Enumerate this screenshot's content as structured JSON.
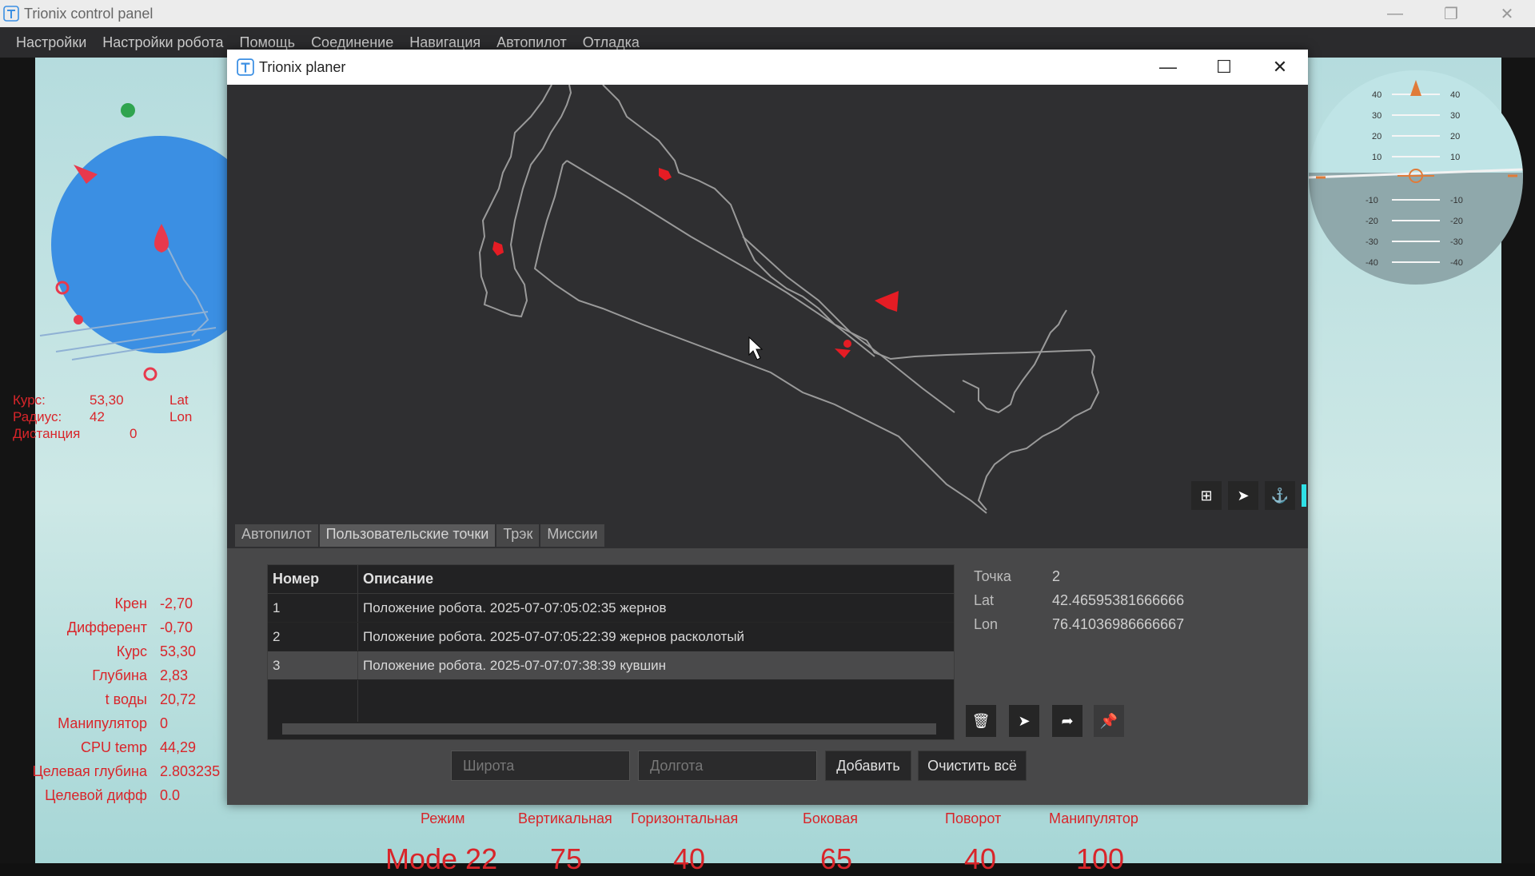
{
  "app": {
    "title": "Trionix control panel"
  },
  "menu": [
    "Настройки",
    "Настройки робота",
    "Помощь",
    "Соединение",
    "Навигация",
    "Автопилот",
    "Отладка"
  ],
  "course_info": [
    {
      "label": "Курс:",
      "value": "53,30",
      "extra": "Lat"
    },
    {
      "label": "Радиус:",
      "value": "42",
      "extra": "Lon"
    },
    {
      "label": "Дистанция",
      "value": "0",
      "extra": ""
    }
  ],
  "telemetry": [
    {
      "label": "Крен",
      "value": "-2,70"
    },
    {
      "label": "Дифферент",
      "value": "-0,70"
    },
    {
      "label": "Курс",
      "value": "53,30"
    },
    {
      "label": "Глубина",
      "value": "2,83"
    },
    {
      "label": "t воды",
      "value": "20,72"
    },
    {
      "label": "Манипулятор",
      "value": "0"
    },
    {
      "label": "CPU temp",
      "value": "44,29"
    },
    {
      "label": "Целевая глубина",
      "value": "2.803235"
    },
    {
      "label": "Целевой дифф",
      "value": "0.0"
    }
  ],
  "bottom_labels": [
    "Режим",
    "Вертикальная",
    "Горизонтальная",
    "Боковая",
    "Поворот",
    "Манипулятор"
  ],
  "bottom_values": [
    "Mode 22",
    "75",
    "40",
    "65",
    "40",
    "100"
  ],
  "horizon_scale": [
    "40",
    "30",
    "20",
    "10",
    "-10",
    "-20",
    "-30",
    "-40"
  ],
  "planer": {
    "title": "Trionix planer",
    "tabs": [
      "Автопилот",
      "Пользовательские точки",
      "Трэк",
      "Миссии"
    ],
    "active_tab": 1,
    "table": {
      "headers": [
        "Номер",
        "Описание"
      ],
      "rows": [
        {
          "num": "1",
          "desc": "Положение робота. 2025-07-07:05:02:35 жернов"
        },
        {
          "num": "2",
          "desc": "Положение робота. 2025-07-07:05:22:39 жернов расколотый"
        },
        {
          "num": "3",
          "desc": "Положение робота. 2025-07-07:07:38:39 кувшин"
        }
      ],
      "selected_row": 2
    },
    "details": [
      {
        "label": "Точка",
        "value": "2"
      },
      {
        "label": "Lat",
        "value": "42.46595381666666"
      },
      {
        "label": "Lon",
        "value": "76.41036986666667"
      }
    ],
    "inputs": {
      "lat_placeholder": "Широта",
      "lon_placeholder": "Долгота"
    },
    "buttons": {
      "add": "Добавить",
      "clear": "Очистить всё"
    },
    "map_icons": [
      "add-point-icon",
      "send-icon",
      "anchor-icon"
    ],
    "panel_icons": [
      "trash-icon",
      "send-icon",
      "share-icon",
      "pin-icon"
    ]
  },
  "colors": {
    "accent_red": "#d9252a",
    "sonar_blue": "#3b8fe3",
    "workspace": "#c2e3e3"
  }
}
